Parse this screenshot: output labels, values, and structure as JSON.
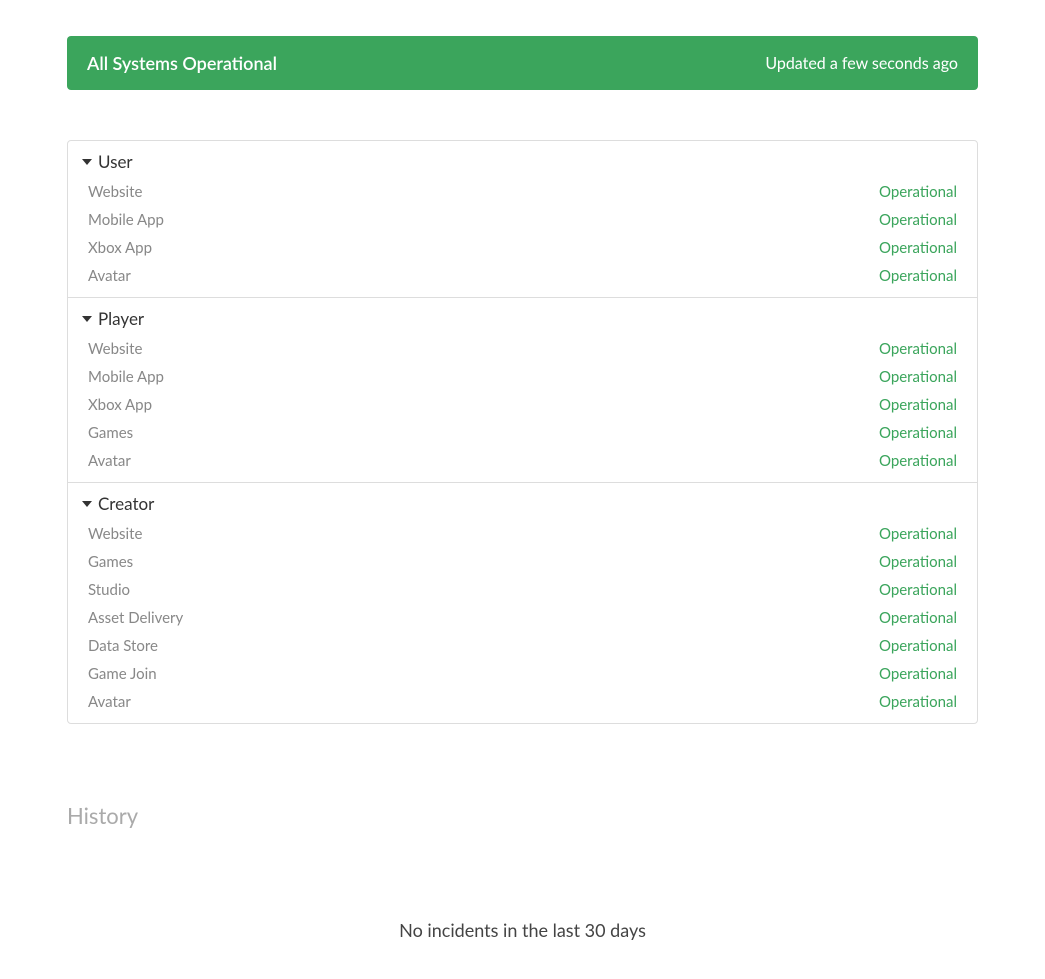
{
  "banner": {
    "title": "All Systems Operational",
    "updated": "Updated a few seconds ago"
  },
  "groups": [
    {
      "name": "User",
      "items": [
        {
          "name": "Website",
          "status": "Operational"
        },
        {
          "name": "Mobile App",
          "status": "Operational"
        },
        {
          "name": "Xbox App",
          "status": "Operational"
        },
        {
          "name": "Avatar",
          "status": "Operational"
        }
      ]
    },
    {
      "name": "Player",
      "items": [
        {
          "name": "Website",
          "status": "Operational"
        },
        {
          "name": "Mobile App",
          "status": "Operational"
        },
        {
          "name": "Xbox App",
          "status": "Operational"
        },
        {
          "name": "Games",
          "status": "Operational"
        },
        {
          "name": "Avatar",
          "status": "Operational"
        }
      ]
    },
    {
      "name": "Creator",
      "items": [
        {
          "name": "Website",
          "status": "Operational"
        },
        {
          "name": "Games",
          "status": "Operational"
        },
        {
          "name": "Studio",
          "status": "Operational"
        },
        {
          "name": "Asset Delivery",
          "status": "Operational"
        },
        {
          "name": "Data Store",
          "status": "Operational"
        },
        {
          "name": "Game Join",
          "status": "Operational"
        },
        {
          "name": "Avatar",
          "status": "Operational"
        }
      ]
    }
  ],
  "history": {
    "title": "History",
    "no_incidents": "No incidents in the last 30 days"
  }
}
